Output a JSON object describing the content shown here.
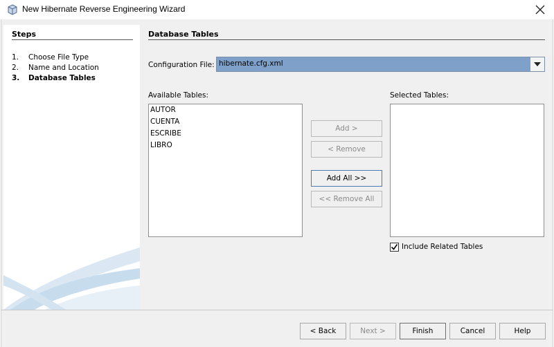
{
  "window": {
    "title": "New Hibernate Reverse Engineering Wizard"
  },
  "steps": {
    "title": "Steps",
    "items": [
      {
        "num": "1.",
        "label": "Choose File Type"
      },
      {
        "num": "2.",
        "label": "Name and Location"
      },
      {
        "num": "3.",
        "label": "Database Tables"
      }
    ]
  },
  "main": {
    "title": "Database Tables",
    "config_label": "Configuration File:",
    "config_value": "hibernate.cfg.xml",
    "available_label": "Available Tables:",
    "available_tables": [
      "AUTOR",
      "CUENTA",
      "ESCRIBE",
      "LIBRO"
    ],
    "selected_label": "Selected Tables:",
    "add_label": "Add >",
    "remove_label": "< Remove",
    "add_all_label": "Add All >>",
    "remove_all_label": "<< Remove All",
    "include_related_label": "Include Related Tables",
    "include_related_checked": true
  },
  "footer": {
    "back_label": "< Back",
    "next_label": "Next >",
    "finish_label": "Finish",
    "cancel_label": "Cancel",
    "help_label": "Help"
  },
  "icons": {
    "app": "netbeans-cube-icon",
    "close": "close-icon",
    "dropdown": "chevron-down-icon",
    "check": "checkmark-icon"
  }
}
